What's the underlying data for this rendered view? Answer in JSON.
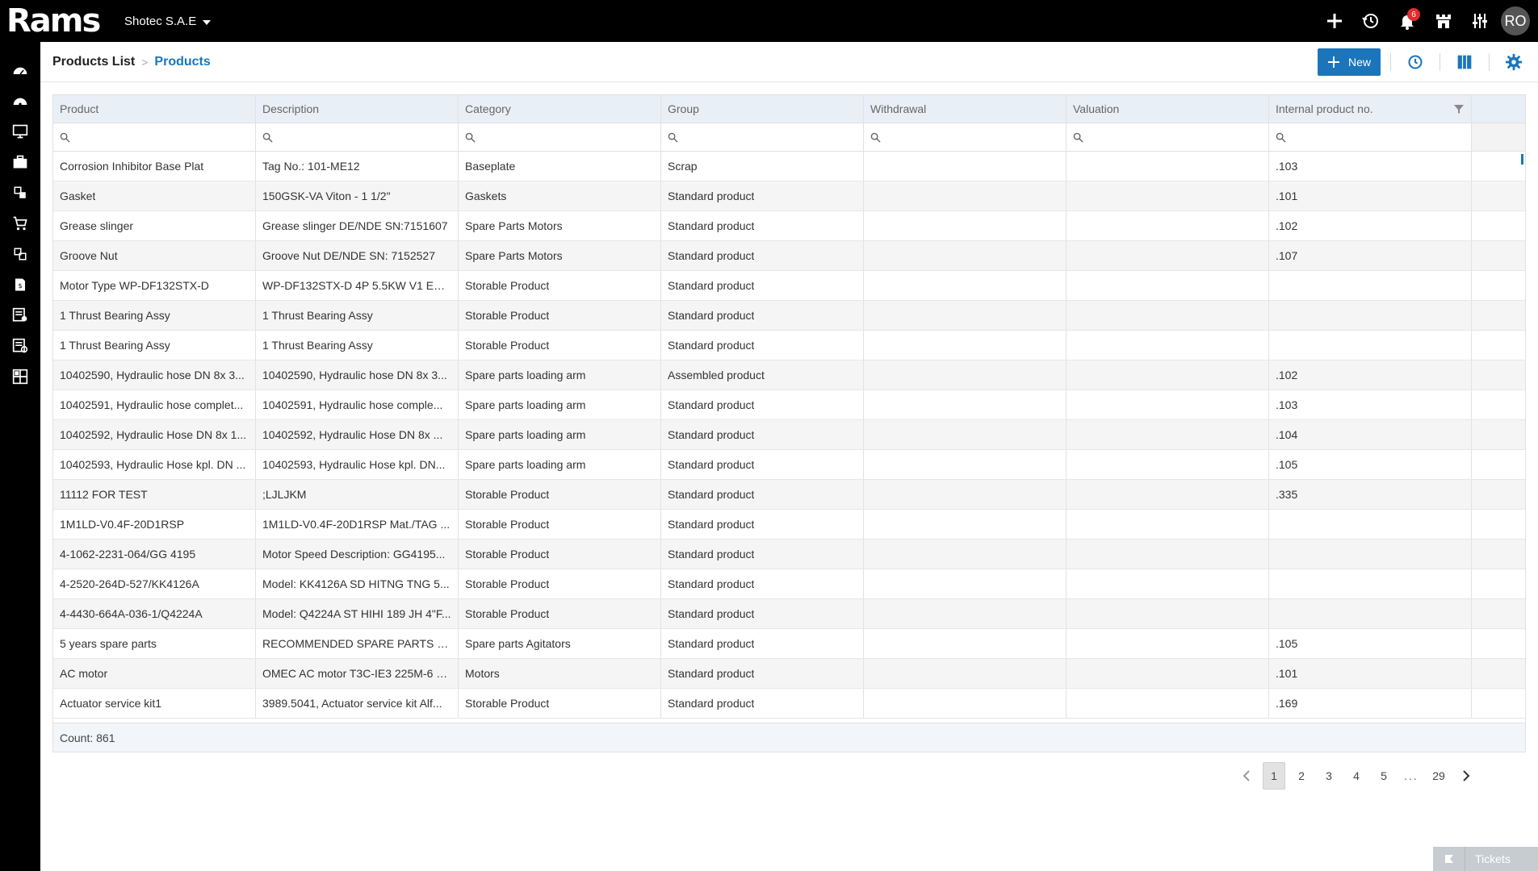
{
  "app": {
    "logo": "Rams",
    "company": "Shotec S.A.E",
    "avatar": "RO",
    "notifications_count": "6"
  },
  "topbar_icons": [
    "plus-icon",
    "history-icon",
    "bell-icon",
    "store-icon",
    "sliders-icon"
  ],
  "sidebar_icons": [
    "dashboard-icon",
    "gauge-icon",
    "monitor-icon",
    "briefcase-icon",
    "modules-icon",
    "cart-icon",
    "transfer-icon",
    "invoice-icon",
    "checklist-icon",
    "report-icon",
    "grid-icon"
  ],
  "breadcrumb": {
    "parent": "Products List",
    "separator": ">",
    "current": "Products"
  },
  "toolbar": {
    "new_label": "New"
  },
  "grid": {
    "columns": [
      "Product",
      "Description",
      "Category",
      "Group",
      "Withdrawal",
      "Valuation",
      "Internal product no."
    ],
    "rows": [
      [
        "Corrosion Inhibitor Base Plat",
        "Tag No.: 101-ME12",
        "Baseplate",
        "Scrap",
        "",
        "",
        ".103"
      ],
      [
        "Gasket",
        "150GSK-VA Viton - 1 1/2\"",
        "Gaskets",
        "Standard product",
        "",
        "",
        ".101"
      ],
      [
        "Grease slinger",
        "Grease slinger DE/NDE SN:7151607",
        "Spare Parts Motors",
        "Standard product",
        "",
        "",
        ".102"
      ],
      [
        "Groove Nut",
        "Groove Nut DE/NDE SN: 7152527",
        "Spare Parts Motors",
        "Standard product",
        "",
        "",
        ".107"
      ],
      [
        "Motor Type WP-DF132STX-D",
        "WP-DF132STX-D 4P 5.5KW V1 EXE...",
        "Storable Product",
        "Standard product",
        "",
        "",
        ""
      ],
      [
        "1 Thrust Bearing Assy",
        "1 Thrust Bearing Assy",
        "Storable Product",
        "Standard product",
        "",
        "",
        ""
      ],
      [
        "1 Thrust Bearing Assy",
        "1 Thrust Bearing Assy",
        "Storable Product",
        "Standard product",
        "",
        "",
        ""
      ],
      [
        "10402590, Hydraulic hose DN 8x 3...",
        "10402590, Hydraulic hose DN 8x 3...",
        "Spare parts loading arm",
        "Assembled product",
        "",
        "",
        ".102"
      ],
      [
        "10402591, Hydraulic hose complet...",
        "10402591, Hydraulic hose comple...",
        "Spare parts loading arm",
        "Standard product",
        "",
        "",
        ".103"
      ],
      [
        "10402592, Hydraulic Hose DN 8x 1...",
        "10402592, Hydraulic Hose DN 8x ...",
        "Spare parts loading arm",
        "Standard product",
        "",
        "",
        ".104"
      ],
      [
        "10402593, Hydraulic Hose kpl. DN ...",
        "10402593, Hydraulic Hose kpl. DN...",
        "Spare parts loading arm",
        "Standard product",
        "",
        "",
        ".105"
      ],
      [
        "11112 FOR TEST",
        ";LJLJKM",
        "Storable Product",
        "Standard product",
        "",
        "",
        ".335"
      ],
      [
        "1M1LD-V0.4F-20D1RSP",
        "1M1LD-V0.4F-20D1RSP Mat./TAG ...",
        "Storable Product",
        "Standard product",
        "",
        "",
        ""
      ],
      [
        "4-1062-2231-064/GG 4195",
        "Motor Speed Description: GG4195...",
        "Storable Product",
        "Standard product",
        "",
        "",
        ""
      ],
      [
        "4-2520-264D-527/KK4126A",
        "Model: KK4126A SD HITNG TNG 5...",
        "Storable Product",
        "Standard product",
        "",
        "",
        ""
      ],
      [
        "4-4430-664A-036-1/Q4224A",
        "Model: Q4224A ST HIHI 189 JH 4\"F...",
        "Storable Product",
        "Standard product",
        "",
        "",
        ""
      ],
      [
        "5 years spare parts",
        "RECOMMENDED SPARE PARTS FO...",
        "Spare parts Agitators",
        "Standard product",
        "",
        "",
        ".105"
      ],
      [
        "AC motor",
        "OMEC AC motor T3C-IE3 225M-6 3...",
        "Motors",
        "Standard product",
        "",
        "",
        ".101"
      ],
      [
        "Actuator service kit1",
        "3989.5041, Actuator service kit Alf...",
        "Storable Product",
        "Standard product",
        "",
        "",
        ".169"
      ]
    ],
    "count_label": "Count: 861"
  },
  "pagination": {
    "pages": [
      "1",
      "2",
      "3",
      "4",
      "5"
    ],
    "dots": "...",
    "last": "29",
    "current": "1"
  },
  "tickets": {
    "label": "Tickets"
  },
  "colors": {
    "accent": "#1b75bb",
    "topbar": "#000000",
    "header_bg": "#e9eff6",
    "badge": "#e52b2b"
  }
}
